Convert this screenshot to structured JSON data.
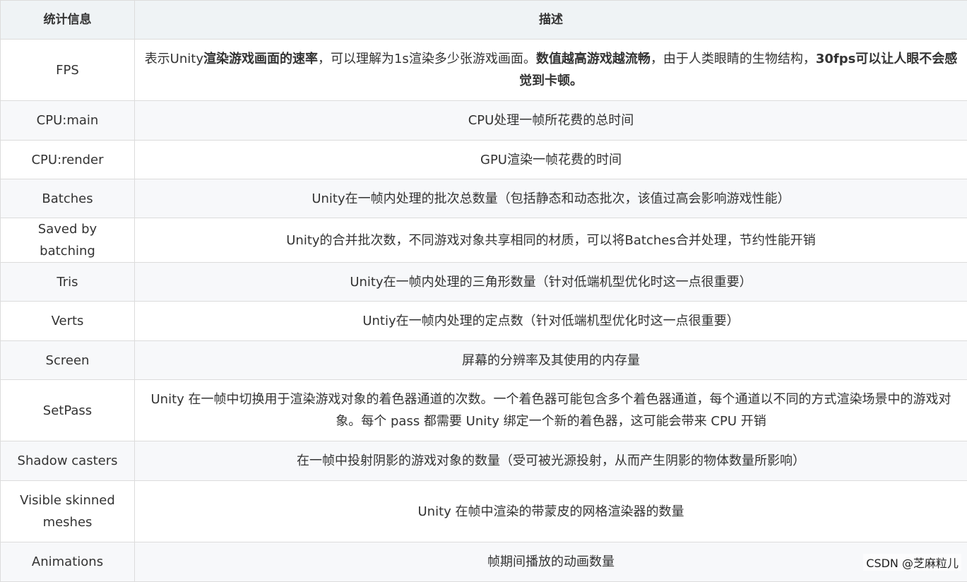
{
  "header": {
    "col1": "统计信息",
    "col2": "描述"
  },
  "rows": [
    {
      "name": "FPS",
      "desc_parts": [
        {
          "t": "表示Unity",
          "b": false
        },
        {
          "t": "渲染游戏画面的速率",
          "b": true
        },
        {
          "t": "，可以理解为1s渲染多少张游戏画面。",
          "b": false
        },
        {
          "t": "数值越高游戏越流畅",
          "b": true
        },
        {
          "t": "，由于人类眼睛的生物结构，",
          "b": false
        },
        {
          "t": "30fps可以让人眼不会感觉到卡顿。",
          "b": true
        }
      ]
    },
    {
      "name": "CPU:main",
      "desc": "CPU处理一帧所花费的总时间"
    },
    {
      "name": "CPU:render",
      "desc": "GPU渲染一帧花费的时间"
    },
    {
      "name": "Batches",
      "desc": "Unity在一帧内处理的批次总数量（包括静态和动态批次，该值过高会影响游戏性能）"
    },
    {
      "name": "Saved by batching",
      "desc": "Unity的合并批次数，不同游戏对象共享相同的材质，可以将Batches合并处理，节约性能开销"
    },
    {
      "name": "Tris",
      "desc": "Unity在一帧内处理的三角形数量（针对低端机型优化时这一点很重要）"
    },
    {
      "name": "Verts",
      "desc": "Untiy在一帧内处理的定点数（针对低端机型优化时这一点很重要）"
    },
    {
      "name": "Screen",
      "desc": "屏幕的分辨率及其使用的内存量"
    },
    {
      "name": "SetPass",
      "desc": "Unity 在一帧中切换用于渲染游戏对象的着色器通道的次数。一个着色器可能包含多个着色器通道，每个通道以不同的方式渲染场景中的游戏对象。每个 pass 都需要 Unity 绑定一个新的着色器，这可能会带来 CPU 开销"
    },
    {
      "name": "Shadow casters",
      "desc": "在一帧中投射阴影的游戏对象的数量（受可被光源投射，从而产生阴影的物体数量所影响）"
    },
    {
      "name": "Visible skinned meshes",
      "desc": "Unity 在帧中渲染的带蒙皮的网格渲染器的数量"
    },
    {
      "name": "Animations",
      "desc": "帧期间播放的动画数量"
    }
  ],
  "watermark": "CSDN @芝麻粒儿"
}
